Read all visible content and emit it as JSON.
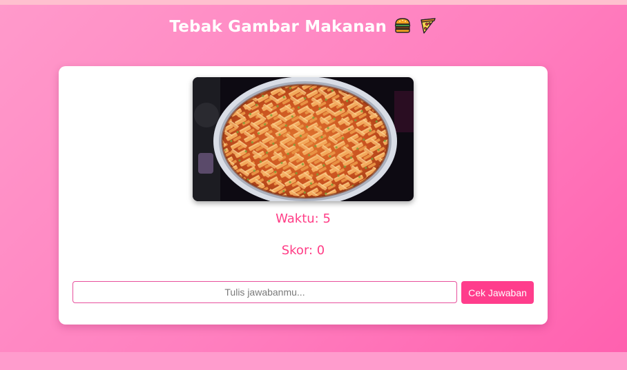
{
  "header": {
    "title": "Tebak Gambar Makanan",
    "emojis": [
      "hamburger-icon",
      "pizza-icon"
    ]
  },
  "game": {
    "image_alt": "penne pasta dish",
    "timer_label": "Waktu: 5",
    "score_label": "Skor: 0"
  },
  "answer": {
    "placeholder": "Tulis jawabanmu...",
    "value": "",
    "submit_label": "Cek Jawaban"
  },
  "colors": {
    "accent": "#ff3d8c",
    "stat_text": "#ff3d86",
    "background": "#ff85c2"
  }
}
